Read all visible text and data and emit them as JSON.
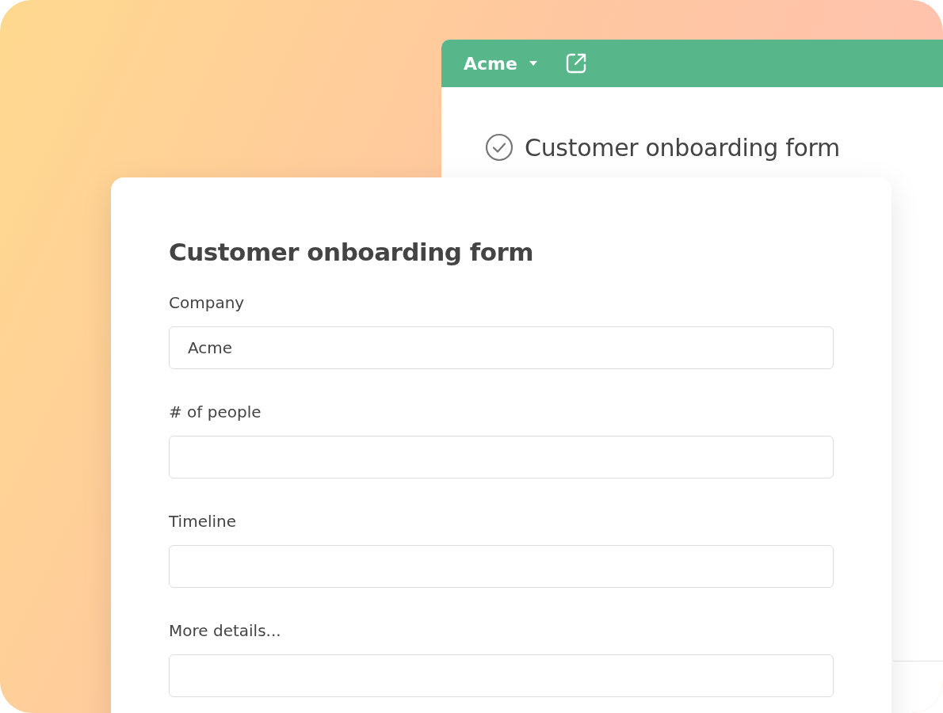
{
  "back_window": {
    "workspace": "Acme",
    "title": "Customer onboarding form"
  },
  "form": {
    "title": "Customer onboarding form",
    "fields": [
      {
        "label": "Company",
        "value": "Acme"
      },
      {
        "label": "# of people"
      },
      {
        "label": "Timeline"
      },
      {
        "label": "More details..."
      }
    ]
  }
}
